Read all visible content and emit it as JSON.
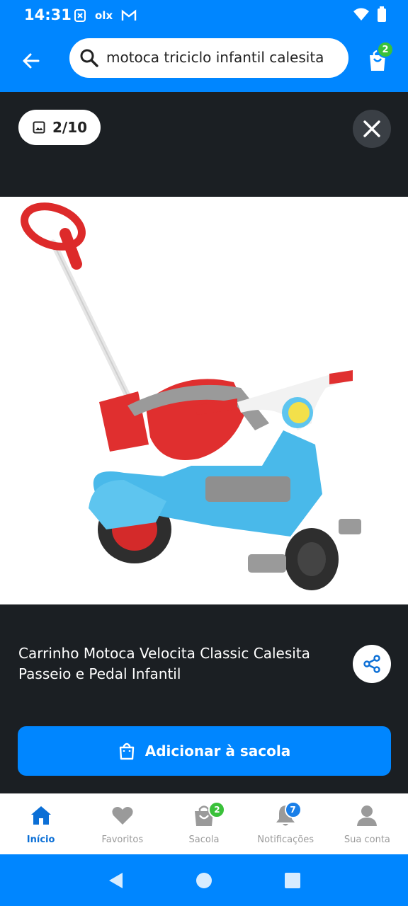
{
  "status_bar": {
    "time": "14:31",
    "olx": "olx"
  },
  "search": {
    "query": "motoca triciclo infantil calesita"
  },
  "cart": {
    "count": "2"
  },
  "gallery": {
    "counter": "2/10"
  },
  "product": {
    "title": "Carrinho Motoca Velocita Classic Calesita Passeio e Pedal Infantil"
  },
  "actions": {
    "add_to_bag": "Adicionar à sacola"
  },
  "bottom_nav": {
    "items": [
      {
        "label": "Início",
        "icon": "home-icon",
        "active": true
      },
      {
        "label": "Favoritos",
        "icon": "heart-icon"
      },
      {
        "label": "Sacola",
        "icon": "bag-icon",
        "badge": "2"
      },
      {
        "label": "Notificações",
        "icon": "bell-icon",
        "badge": "7"
      },
      {
        "label": "Sua conta",
        "icon": "person-icon"
      }
    ]
  },
  "colors": {
    "brand_blue": "#0086ff",
    "dark_background": "#1b1f23",
    "active_nav": "#0b6fd6",
    "badge_green": "#3ac13a",
    "badge_blue": "#1a7fe8"
  }
}
